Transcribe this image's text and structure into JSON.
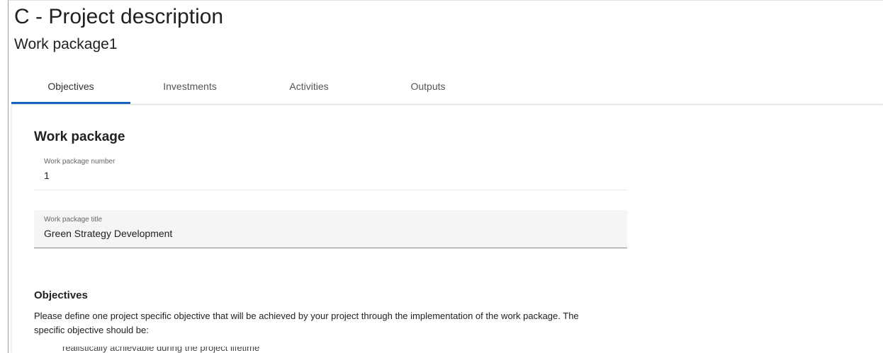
{
  "header": {
    "title": "C - Project description",
    "subtitle": "Work package1"
  },
  "tabs": [
    {
      "label": "Objectives",
      "active": true
    },
    {
      "label": "Investments",
      "active": false
    },
    {
      "label": "Activities",
      "active": false
    },
    {
      "label": "Outputs",
      "active": false
    }
  ],
  "work_package": {
    "heading": "Work package",
    "number_label": "Work package number",
    "number_value": "1",
    "title_label": "Work package title",
    "title_value": "Green Strategy Development"
  },
  "objectives": {
    "heading": "Objectives",
    "text": "Please define one project specific objective that will be achieved by your project through the implementation of the work package. The specific objective should be:",
    "clipped_bullet": "realistically achievable during the project lifetime"
  },
  "colors": {
    "active_tab_indicator": "#1565c0",
    "field_fill": "#f5f5f5"
  }
}
